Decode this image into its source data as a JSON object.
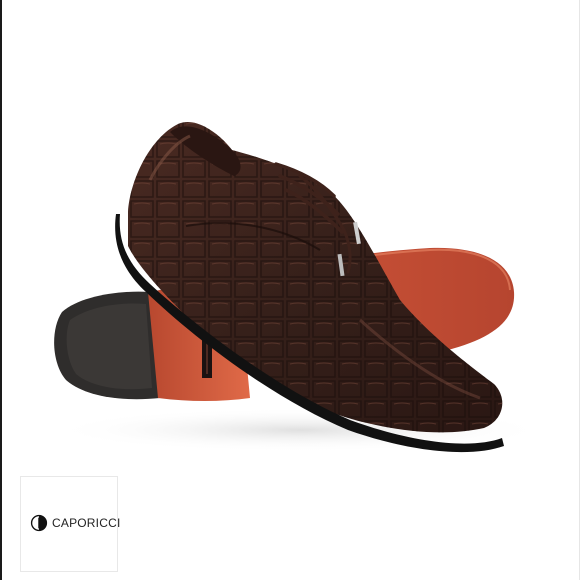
{
  "product": {
    "image_subject": "brown-crocodile-oxford-shoes-icon",
    "colors": {
      "leather": "#3a201a",
      "sole": "#c4533a",
      "heel": "#2f2d2c",
      "background": "#ffffff"
    }
  },
  "brand": {
    "name": "CAPORICCI",
    "logo_icon": "caporicci-logo-icon"
  }
}
